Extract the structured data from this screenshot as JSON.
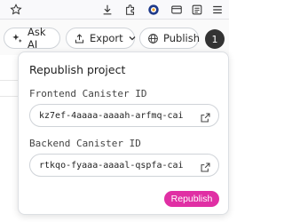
{
  "browser_toolbar": {
    "icons": [
      "star-icon",
      "download-icon",
      "extension-icon",
      "account-icon",
      "windows-icon",
      "reader-icon",
      "menu-icon"
    ]
  },
  "header": {
    "ask_ai_label": "Ask AI",
    "export_label": "Export",
    "publish_label": "Publish",
    "avatar_initial": "1"
  },
  "popover": {
    "title": "Republish project",
    "frontend_label": "Frontend Canister ID",
    "frontend_id": "kz7ef-4aaaa-aaaah-arfmq-cai",
    "backend_label": "Backend Canister ID",
    "backend_id": "rtkqo-fyaaa-aaaal-qspfa-cai",
    "republish_label": "Republish"
  },
  "colors": {
    "accent": "#e02fa4",
    "avatar_bg": "#333333",
    "border": "#cfd3d8"
  }
}
